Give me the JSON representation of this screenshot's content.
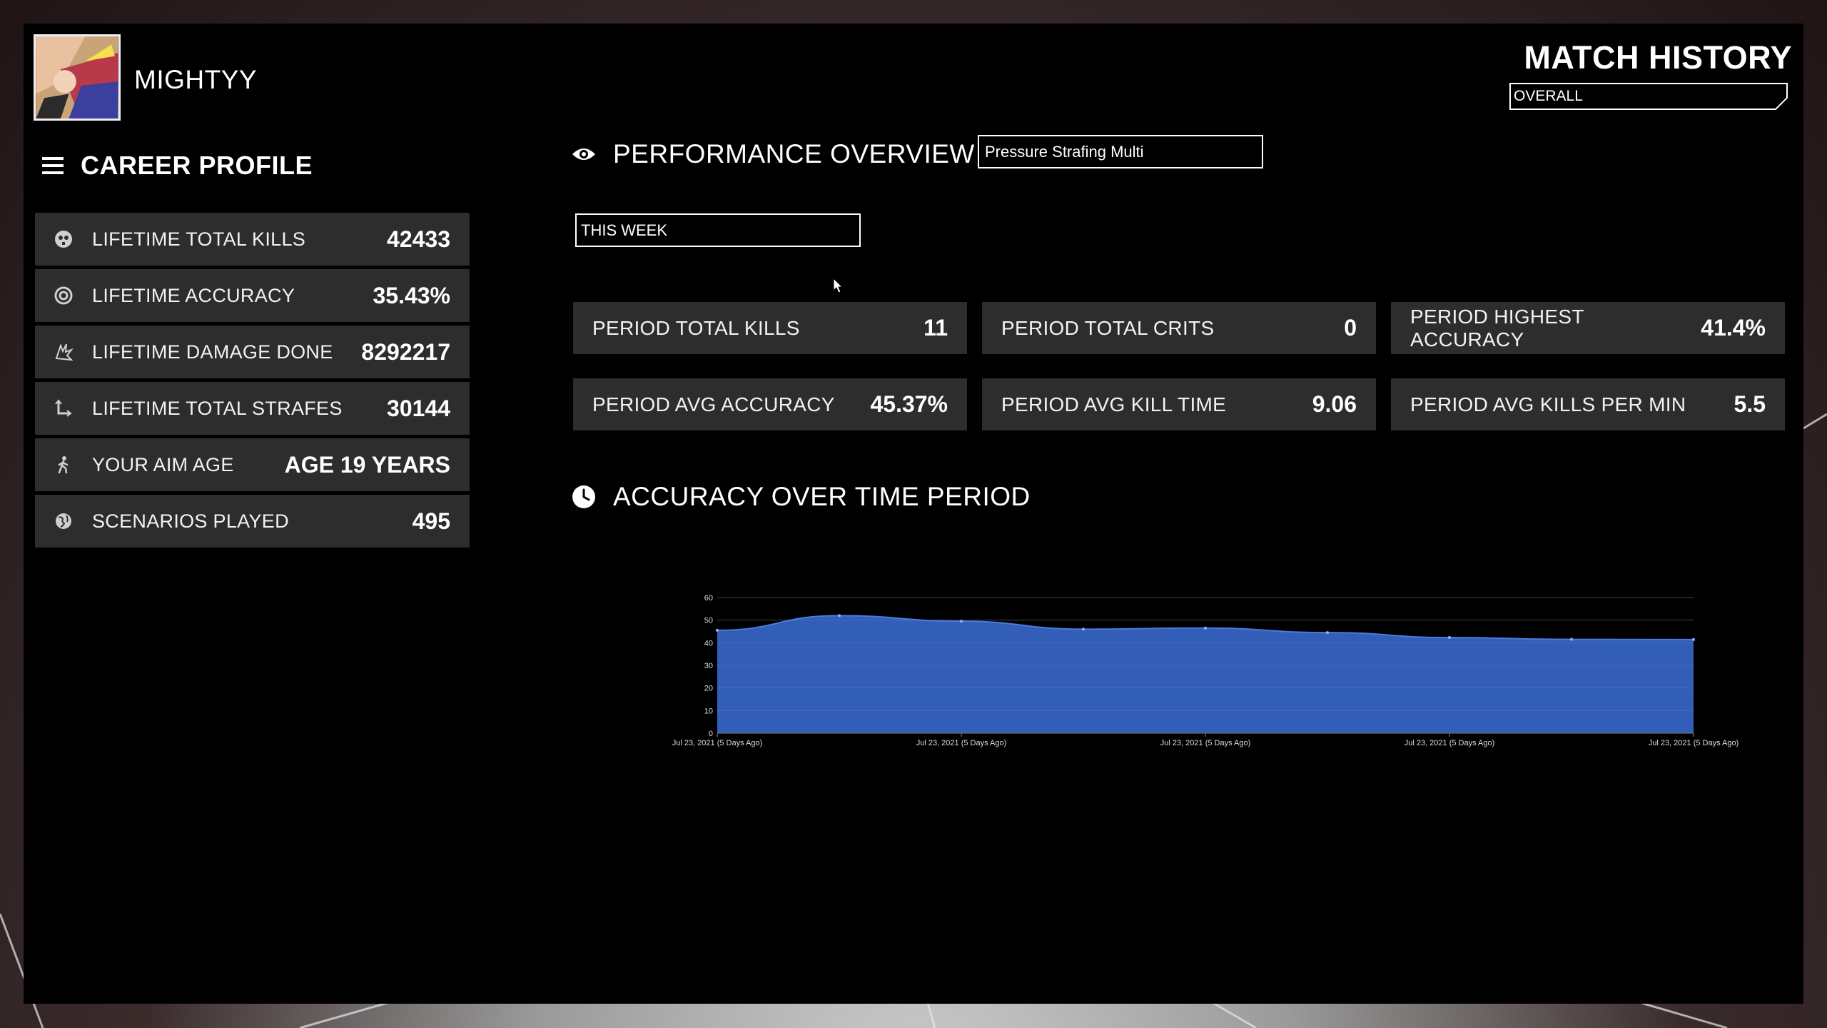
{
  "header": {
    "username": "MIGHTYY",
    "match_history_title": "MATCH HISTORY",
    "match_history_select": "OVERALL"
  },
  "career_profile": {
    "title": "CAREER PROFILE",
    "items": [
      {
        "icon": "skull-icon",
        "label": "LIFETIME TOTAL KILLS",
        "value": "42433"
      },
      {
        "icon": "target-icon",
        "label": "LIFETIME ACCURACY",
        "value": "35.43%"
      },
      {
        "icon": "explosion-icon",
        "label": "LIFETIME DAMAGE DONE",
        "value": "8292217"
      },
      {
        "icon": "strafe-arrow-icon",
        "label": "LIFETIME TOTAL STRAFES",
        "value": "30144"
      },
      {
        "icon": "walking-person-icon",
        "label": "YOUR AIM AGE",
        "value": "AGE 19 YEARS"
      },
      {
        "icon": "globe-icon",
        "label": "SCENARIOS PLAYED",
        "value": "495"
      }
    ]
  },
  "performance": {
    "title": "PERFORMANCE OVERVIEW",
    "scenario": "Pressure Strafing Multi",
    "period": "THIS WEEK",
    "stats": [
      {
        "label": "PERIOD TOTAL KILLS",
        "value": "11"
      },
      {
        "label": "PERIOD TOTAL CRITS",
        "value": "0"
      },
      {
        "label": "PERIOD HIGHEST ACCURACY",
        "value": "41.4%"
      },
      {
        "label": "PERIOD AVG ACCURACY",
        "value": "45.37%"
      },
      {
        "label": "PERIOD AVG KILL TIME",
        "value": "9.06"
      },
      {
        "label": "PERIOD AVG KILLS PER MIN",
        "value": "5.5"
      }
    ]
  },
  "accuracy_section": {
    "title": "ACCURACY OVER TIME PERIOD"
  },
  "chart_data": {
    "type": "area",
    "title": "",
    "xlabel": "",
    "ylabel": "",
    "ylim": [
      0,
      60
    ],
    "yticks": [
      0,
      10,
      20,
      30,
      40,
      50,
      60
    ],
    "x_tick_labels": [
      "Jul 23, 2021 (5 Days Ago)",
      "Jul 23, 2021 (5 Days Ago)",
      "Jul 23, 2021 (5 Days Ago)",
      "Jul 23, 2021 (5 Days Ago)",
      "Jul 23, 2021 (5 Days Ago)"
    ],
    "values": [
      45.5,
      52.0,
      49.5,
      46.0,
      46.5,
      44.5,
      42.3,
      41.5,
      41.4
    ],
    "grid": true,
    "fill_color": "#3563c1",
    "line_color": "#4a7ae0"
  },
  "colors": {
    "panel": "#000000",
    "card": "#2d2d2d",
    "text": "#ffffff"
  }
}
